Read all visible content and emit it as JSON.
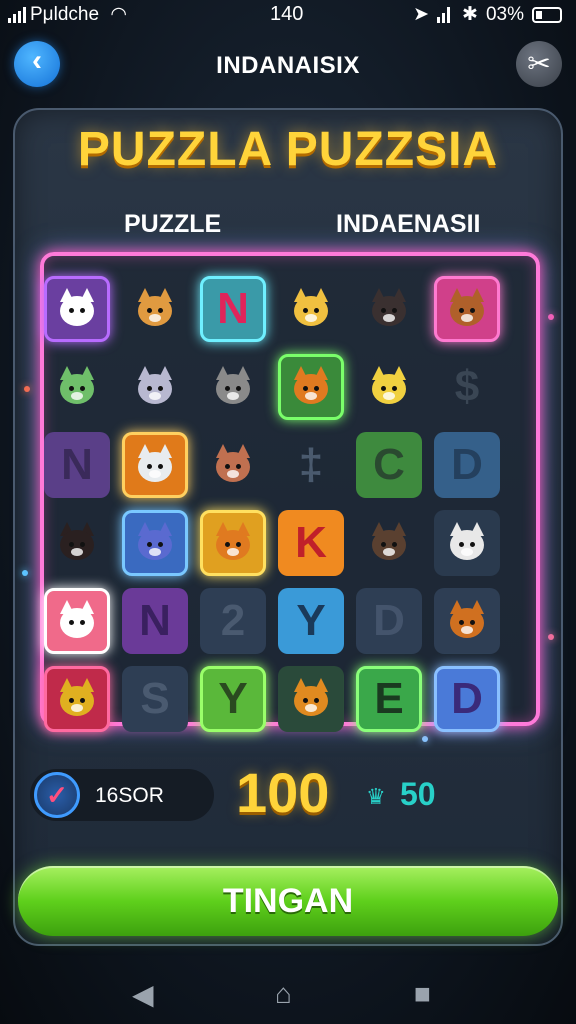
{
  "status_bar": {
    "carrier": "Pμldche",
    "time": "140",
    "battery": "03%"
  },
  "header": {
    "title": "INDANAISIX"
  },
  "game": {
    "title": "PUZZLA PUZZSIA",
    "column_labels": [
      "PUZZLE",
      "INDAENASII"
    ],
    "tiles": [
      {
        "kind": "animal",
        "icon": "cat-icon",
        "bg": "#6a3fa0",
        "border": "#b86cff",
        "color": "#ffffff"
      },
      {
        "kind": "animal",
        "icon": "calico-cat-icon",
        "bg": "transparent",
        "border": "transparent",
        "color": "#e09a40"
      },
      {
        "kind": "letter",
        "text": "N",
        "bg": "#3a9aa8",
        "border": "#6ff0ff",
        "color": "#e0245a"
      },
      {
        "kind": "animal",
        "icon": "fox-icon",
        "bg": "transparent",
        "border": "transparent",
        "color": "#f0c040"
      },
      {
        "kind": "animal",
        "icon": "girl-icon",
        "bg": "transparent",
        "border": "transparent",
        "color": "#3a3030"
      },
      {
        "kind": "animal",
        "icon": "dog-icon",
        "bg": "#d0408a",
        "border": "#ff7ad0",
        "color": "#b0602a"
      },
      {
        "kind": "animal",
        "icon": "goblin-cat-icon",
        "bg": "transparent",
        "border": "transparent",
        "color": "#6fbf6a"
      },
      {
        "kind": "animal",
        "icon": "hooded-cat-icon",
        "bg": "transparent",
        "border": "transparent",
        "color": "#b8b8d0"
      },
      {
        "kind": "animal",
        "icon": "tabby-cat-icon",
        "bg": "transparent",
        "border": "transparent",
        "color": "#8a8a8a"
      },
      {
        "kind": "animal",
        "icon": "orange-cat-icon",
        "bg": "#3a8a3a",
        "border": "#7aff6a",
        "color": "#e07a20"
      },
      {
        "kind": "animal",
        "icon": "mouse-icon",
        "bg": "transparent",
        "border": "transparent",
        "color": "#f0d040"
      },
      {
        "kind": "letter",
        "text": "$",
        "bg": "transparent",
        "border": "transparent",
        "color": "#3a4654"
      },
      {
        "kind": "letter",
        "text": "N",
        "bg": "#5a3f88",
        "border": "transparent",
        "color": "#3a2a5a"
      },
      {
        "kind": "animal",
        "icon": "calico-cat-icon",
        "bg": "#e07a1a",
        "border": "#ffd060",
        "color": "#e8ecef"
      },
      {
        "kind": "animal",
        "icon": "girl-icon",
        "bg": "transparent",
        "border": "transparent",
        "color": "#c07050"
      },
      {
        "kind": "letter",
        "text": "‡",
        "bg": "transparent",
        "border": "transparent",
        "color": "#4a5a6e"
      },
      {
        "kind": "letter",
        "text": "C",
        "bg": "#3e8a3e",
        "border": "transparent",
        "color": "#2a4a30"
      },
      {
        "kind": "letter",
        "text": "D",
        "bg": "#35608a",
        "border": "transparent",
        "color": "#24405e"
      },
      {
        "kind": "animal",
        "icon": "girl-icon",
        "bg": "transparent",
        "border": "transparent",
        "color": "#2a2020"
      },
      {
        "kind": "animal",
        "icon": "blue-cat-icon",
        "bg": "#3a6ac0",
        "border": "#7ac8ff",
        "color": "#5a6ad0"
      },
      {
        "kind": "animal",
        "icon": "fox-icon",
        "bg": "#e0a020",
        "border": "#ffe060",
        "color": "#e07a20"
      },
      {
        "kind": "letter",
        "text": "K",
        "bg": "#f08a20",
        "border": "transparent",
        "color": "#c0202a"
      },
      {
        "kind": "animal",
        "icon": "tabby-cat-icon",
        "bg": "transparent",
        "border": "transparent",
        "color": "#5a4030"
      },
      {
        "kind": "animal",
        "icon": "husky-icon",
        "bg": "#2a3a4e",
        "border": "transparent",
        "color": "#e8e8e8"
      },
      {
        "kind": "animal",
        "icon": "white-cat-icon",
        "bg": "#f06a8a",
        "border": "#ffffff",
        "color": "#ffffff"
      },
      {
        "kind": "letter",
        "text": "N",
        "bg": "#6a3a98",
        "border": "transparent",
        "color": "#3a2060"
      },
      {
        "kind": "letter",
        "text": "2",
        "bg": "#2e3e54",
        "border": "transparent",
        "color": "#4a5a70"
      },
      {
        "kind": "letter",
        "text": "Y",
        "bg": "#3a9ad8",
        "border": "transparent",
        "color": "#1a3a5a"
      },
      {
        "kind": "letter",
        "text": "D",
        "bg": "#2e3e54",
        "border": "transparent",
        "color": "#44546c"
      },
      {
        "kind": "animal",
        "icon": "fox-icon",
        "bg": "#2e3e54",
        "border": "transparent",
        "color": "#d07020"
      },
      {
        "kind": "animal",
        "icon": "cat-icon",
        "bg": "#c02a4a",
        "border": "#ff6aa0",
        "color": "#e0b020"
      },
      {
        "kind": "letter",
        "text": "S",
        "bg": "#2e3e54",
        "border": "transparent",
        "color": "#4a5a70"
      },
      {
        "kind": "letter",
        "text": "Y",
        "bg": "#5ab83a",
        "border": "#9aff6a",
        "color": "#2a4a20"
      },
      {
        "kind": "animal",
        "icon": "fox-icon",
        "bg": "#2a4a3a",
        "border": "transparent",
        "color": "#e08a20"
      },
      {
        "kind": "letter",
        "text": "E",
        "bg": "#3aa84a",
        "border": "#8aff7a",
        "color": "#1a3a20"
      },
      {
        "kind": "letter",
        "text": "D",
        "bg": "#4a7ad8",
        "border": "#8ac0ff",
        "color": "#3a2a7a"
      }
    ]
  },
  "score": {
    "label": "16SOR",
    "points": "100",
    "bonus": "50",
    "crown_icon": "♛"
  },
  "actions": {
    "play_label": "TINGAN"
  },
  "colors": {
    "accent_gold": "#ffd43a",
    "accent_teal": "#28d0c8",
    "play_green": "#5fd01c"
  }
}
